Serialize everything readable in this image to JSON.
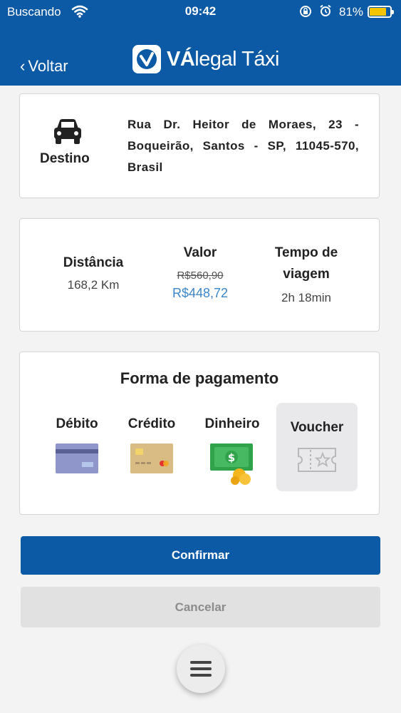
{
  "status_bar": {
    "carrier": "Buscando",
    "time": "09:42",
    "battery_pct": "81%",
    "battery_level": 0.81
  },
  "header": {
    "back_label": "Voltar",
    "brand_bold": "VÁ",
    "brand_rest": "legal Táxi"
  },
  "destination": {
    "label": "Destino",
    "address": "Rua Dr. Heitor de Moraes, 23 - Boqueirão, Santos - SP, 11045-570, Brasil"
  },
  "trip": {
    "distance_title": "Distância",
    "distance_value": "168,2 Km",
    "value_title": "Valor",
    "value_old": "R$560,90",
    "value_new": "R$448,72",
    "time_title_line1": "Tempo de",
    "time_title_line2": "viagem",
    "time_value": "2h 18min"
  },
  "payment": {
    "title": "Forma de pagamento",
    "options": [
      {
        "label": "Débito",
        "icon": "debit-card-icon"
      },
      {
        "label": "Crédito",
        "icon": "credit-card-icon"
      },
      {
        "label": "Dinheiro",
        "icon": "cash-icon"
      },
      {
        "label": "Voucher",
        "icon": "voucher-ticket-icon",
        "selected": true
      }
    ]
  },
  "actions": {
    "confirm_label": "Confirmar",
    "cancel_label": "Cancelar"
  },
  "colors": {
    "primary": "#0c5aa6",
    "price_new": "#3a86c9",
    "battery": "#f5c400"
  }
}
